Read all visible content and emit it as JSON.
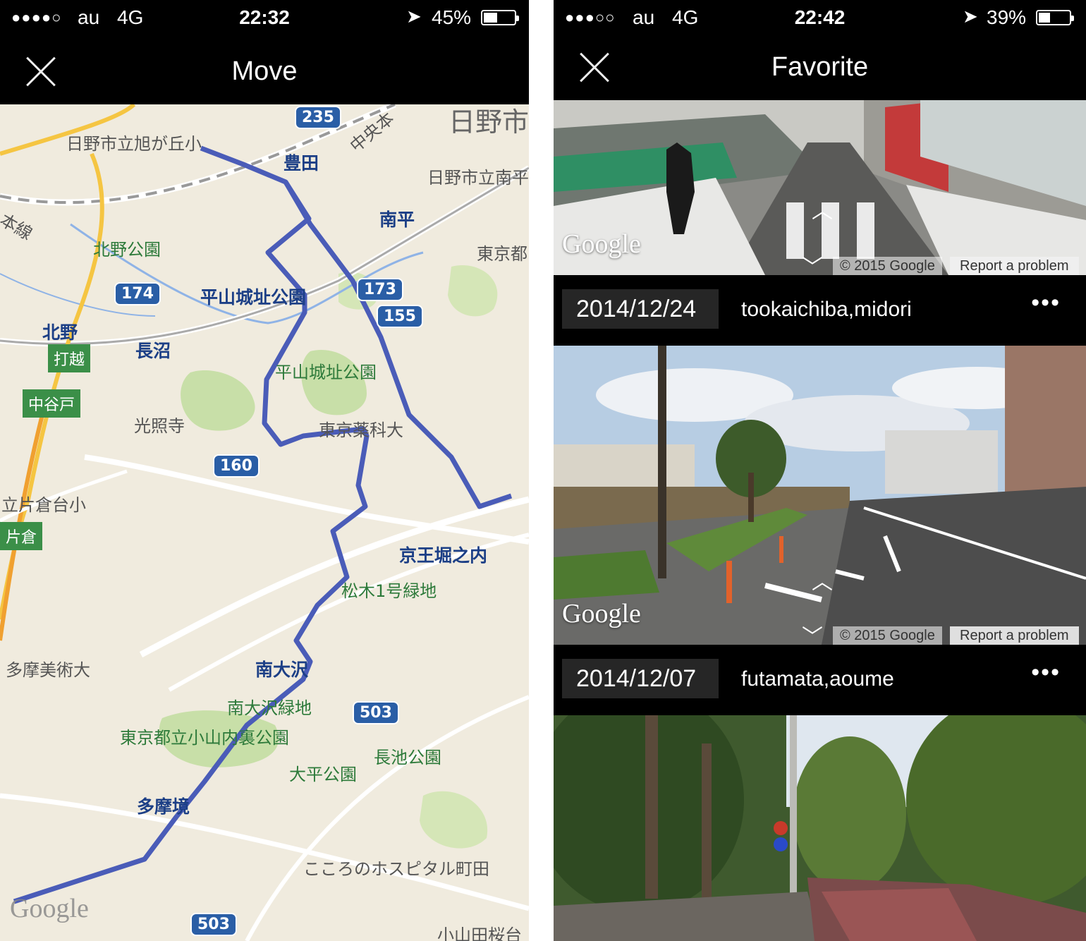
{
  "left_screen": {
    "status_bar": {
      "signal": "●●●●○",
      "carrier": "au",
      "network": "4G",
      "time": "22:32",
      "battery_pct": "45%",
      "battery_level": 0.45
    },
    "title": "Move",
    "map": {
      "labels": {
        "hino_big": "日野市",
        "asahigaoka": "日野市立旭が丘小",
        "toyoda": "豊田",
        "chuo": "中央本",
        "hino_minamidaira": "日野市立南平",
        "minamidaira": "南平",
        "honsen": "本線",
        "kitano_park": "北野公園",
        "tokyo_to": "東京都",
        "hirayama_park_bold": "平山城址公園",
        "kitano": "北野",
        "naganuma": "長沼",
        "hirayama_park": "平山城址公園",
        "koshoji": "光照寺",
        "yakka": "東京薬科大",
        "katakura_sho": "立片倉台小",
        "horinouchi": "京王堀之内",
        "matsuki": "松木1号緑地",
        "tama_bijutsu": "多摩美術大",
        "minamiosawa": "南大沢",
        "minamiosawa_ryokuchi": "南大沢緑地",
        "oyamauchiura": "東京都立小山内裏公園",
        "nagaike": "長池公園",
        "ohira": "大平公園",
        "tamasakai": "多摩境",
        "kokoro": "こころのホスピタル町田",
        "oyamada": "小山田桜台"
      },
      "stations": {
        "uchikoshi": "打越",
        "nakagoto": "中谷戸",
        "katakura": "片倉"
      },
      "shields": {
        "r235": "235",
        "r174": "174",
        "r173": "173",
        "r155": "155",
        "r160": "160",
        "r503a": "503",
        "r503b": "503"
      },
      "logo": "Google"
    }
  },
  "right_screen": {
    "status_bar": {
      "signal": "●●●○○",
      "carrier": "au",
      "network": "4G",
      "time": "22:42",
      "battery_pct": "39%",
      "battery_level": 0.39
    },
    "title": "Favorite",
    "streetview_logo": "Google",
    "copyright": "© 2015 Google",
    "report": "Report a problem",
    "items": [
      {
        "date": "2014/12/24",
        "name": "tookaichiba,midori",
        "more": "•••"
      },
      {
        "date": "2014/12/07",
        "name": "futamata,aoume",
        "more": "•••"
      }
    ]
  },
  "colors": {
    "route": "#4a5cb8",
    "bar": "#111111",
    "map_bg": "#f0ebde"
  }
}
